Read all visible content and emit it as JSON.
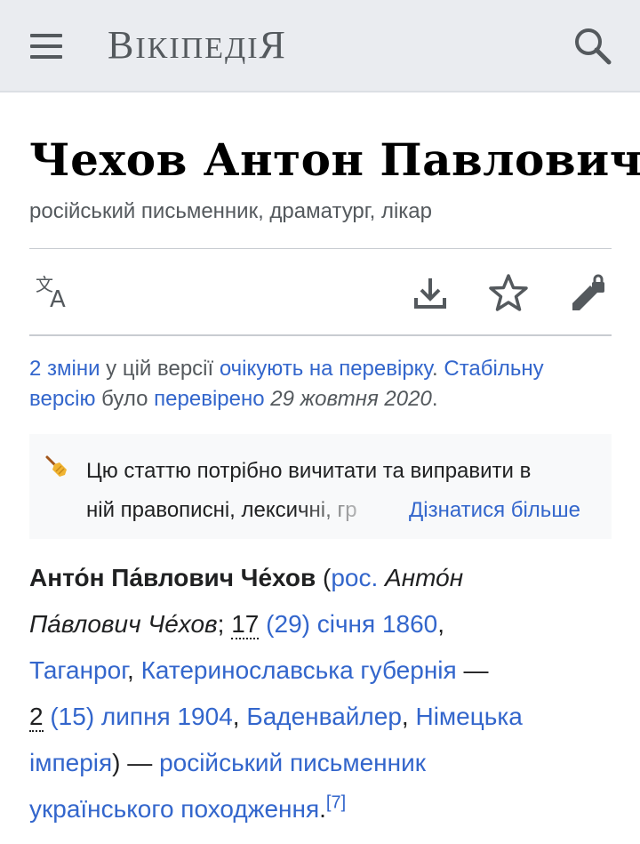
{
  "header": {
    "logo_big": "В",
    "logo_rest": "ікіпедія",
    "logo_end": "я"
  },
  "article": {
    "title": "Чехов Антон Павлович",
    "description": "російський письменник, драматург, лікар"
  },
  "toolbar": {
    "language_icon": "translate-icon",
    "download_icon": "download-icon",
    "watch_icon": "star-icon",
    "edit_icon": "edit-locked-icon"
  },
  "revision": {
    "changes_link": "2 зміни",
    "text1": " у цій версії ",
    "pending_link": "очікують на перевірку",
    "text2": ". ",
    "stable_link_a": "Стабільну",
    "stable_link_b": "версію",
    "text3": " було ",
    "checked_link": "перевірено",
    "date": "29 жовтня 2020",
    "text4": "."
  },
  "cleanup": {
    "line1": "Цю статтю потрібно вичитати та виправити в",
    "line2": "ній правописні, лексичні, гр",
    "learn_more": "Дізнатися більше"
  },
  "lead": {
    "name_bold": "Анто́н Па́влович Че́хов",
    "paren_open": " (",
    "lang_link": "рос.",
    "ru_name_a": " Анто́н",
    "ru_name_b": "Па́влович Че́хов",
    "semicolon": "; ",
    "birth_day_os": "17",
    "birth_link": "(29) січня 1860",
    "comma1": ",",
    "city_link": "Таганрог",
    "comma2": ", ",
    "gubernia_link": "Катеринославська губернія",
    "dash1": " —",
    "death_day_os": "2",
    "death_link": "(15) липня 1904",
    "comma3": ", ",
    "death_place_link": "Баденвайлер",
    "comma4": ", ",
    "empire_link_a": "Німецька",
    "empire_link_b": "імперія",
    "paren_close": ")  — ",
    "desc_link_a": "російський письменник",
    "desc_link_b": "українського походження",
    "period": ".",
    "ref": "[7]"
  }
}
